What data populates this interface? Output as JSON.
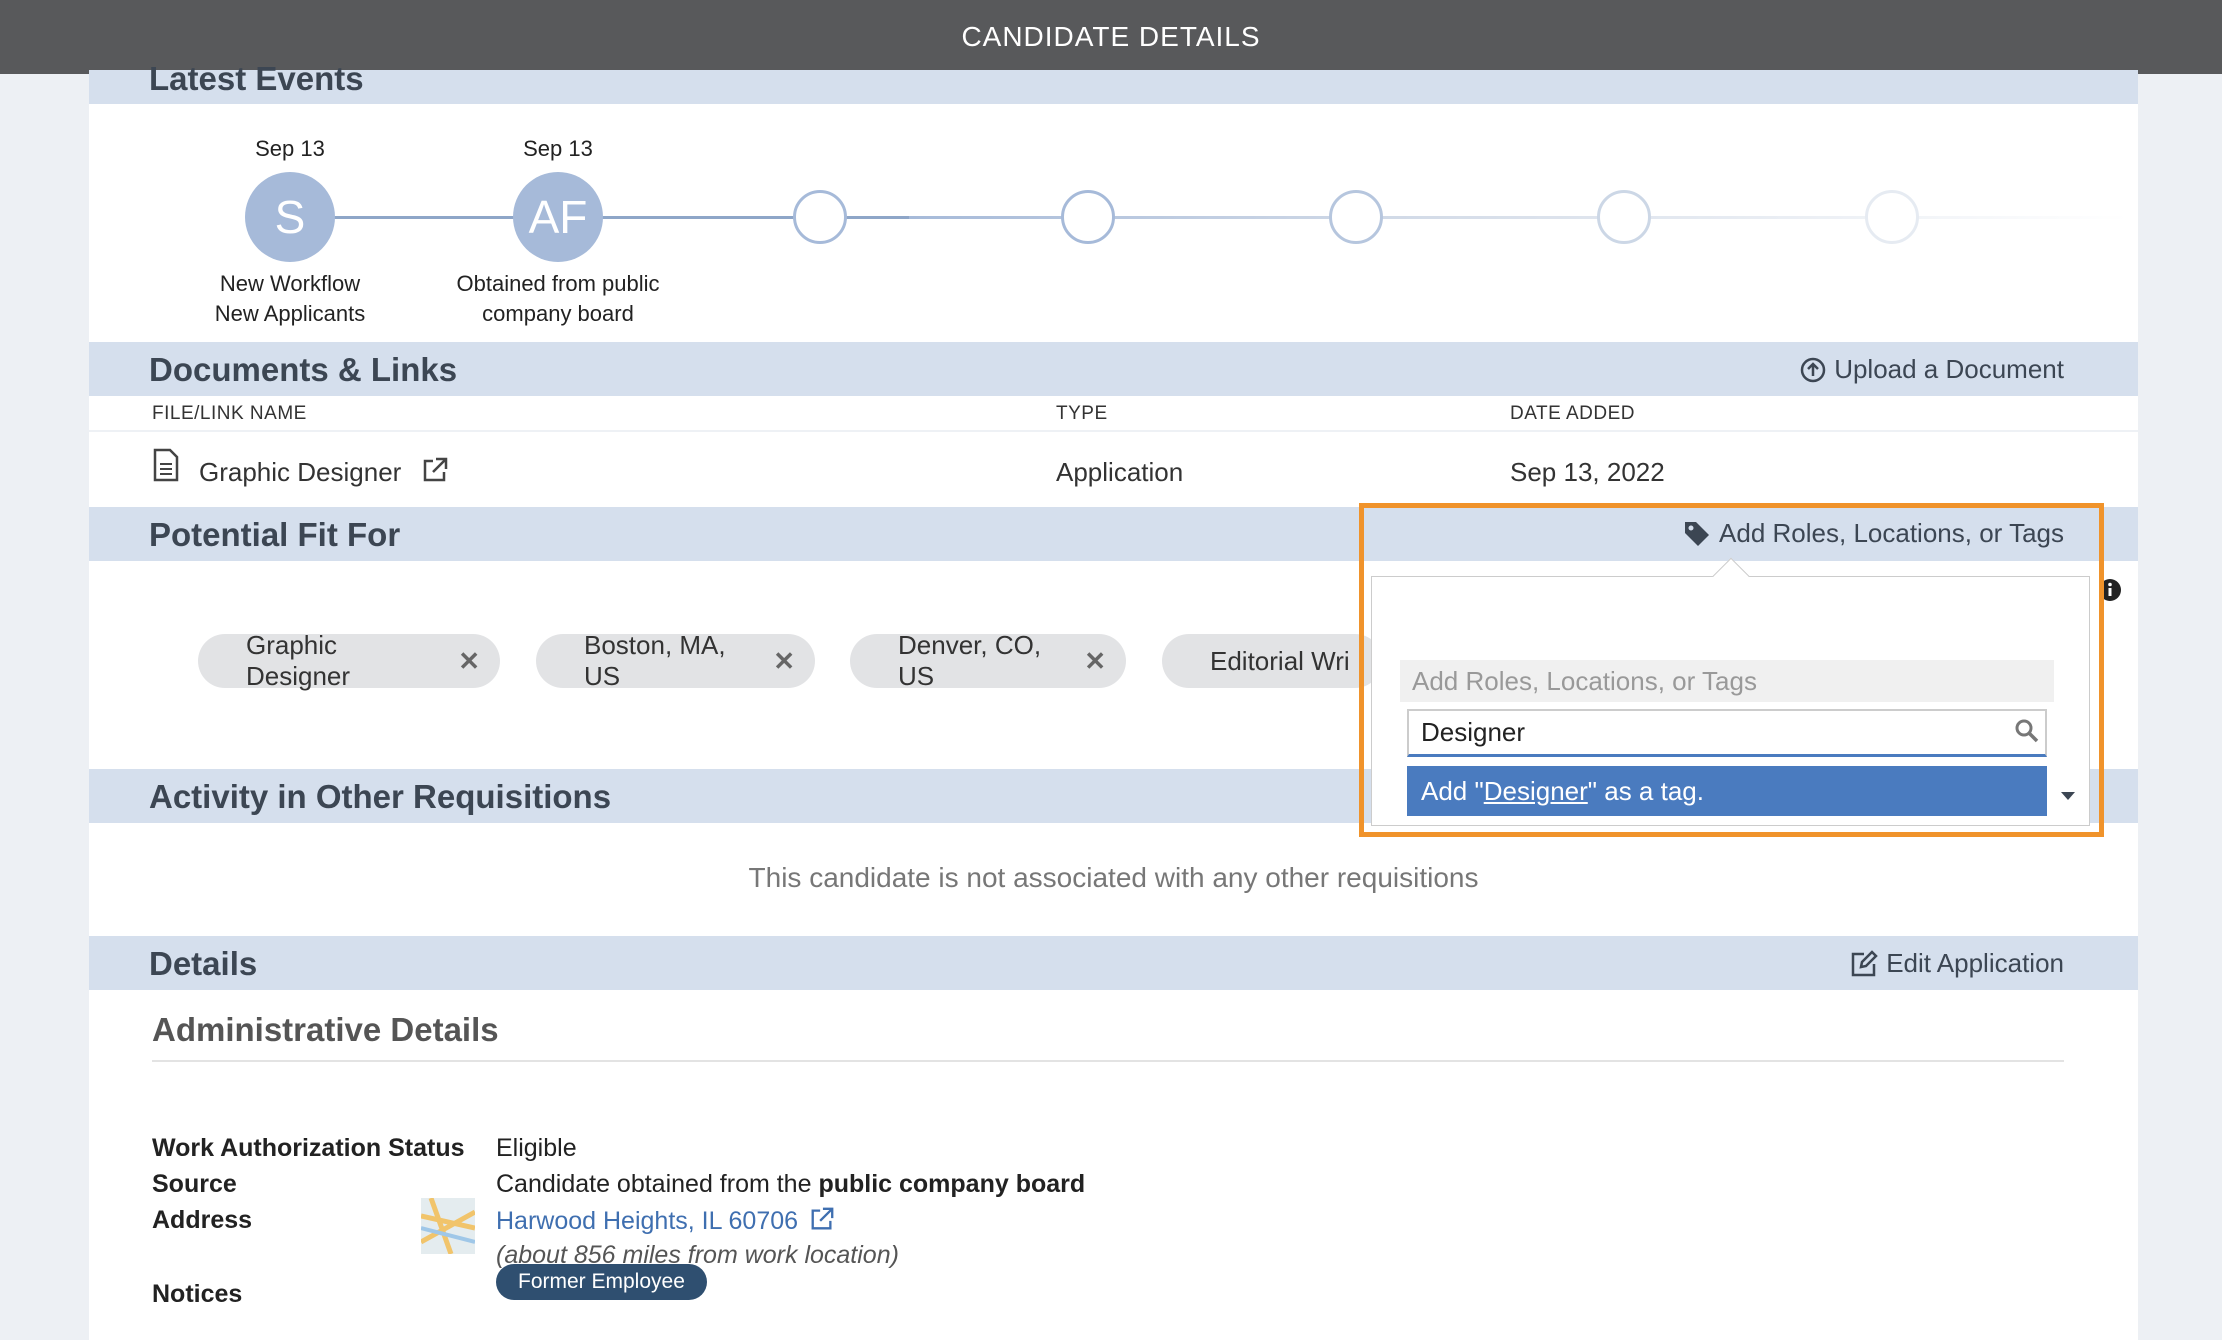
{
  "window": {
    "title": "CANDIDATE DETAILS"
  },
  "latest_events": {
    "title": "Latest Events",
    "events": [
      {
        "date": "Sep 13",
        "initials": "S",
        "label_line1": "New Workflow",
        "label_line2": "New Applicants"
      },
      {
        "date": "Sep 13",
        "initials": "AF",
        "label_line1": "Obtained from public",
        "label_line2": "company board"
      }
    ]
  },
  "documents": {
    "title": "Documents & Links",
    "upload_label": "Upload a Document",
    "columns": {
      "name": "FILE/LINK NAME",
      "type": "TYPE",
      "date": "DATE ADDED"
    },
    "rows": [
      {
        "name": "Graphic Designer",
        "type": "Application",
        "date": "Sep 13, 2022"
      }
    ]
  },
  "potential_fit": {
    "title": "Potential Fit For",
    "add_label": "Add Roles, Locations, or Tags",
    "chips": [
      "Graphic Designer",
      "Boston, MA, US",
      "Denver, CO, US",
      "Editorial Wri"
    ]
  },
  "tag_dropdown": {
    "placeholder": "Add Roles, Locations, or Tags",
    "search_value": "Designer",
    "option_prefix": "Add \"",
    "option_term": "Designer",
    "option_suffix": "\" as a tag."
  },
  "activity": {
    "title": "Activity in Other Requisitions",
    "empty_message": "This candidate is not associated with any other requisitions"
  },
  "details": {
    "title": "Details",
    "edit_label": "Edit Application",
    "admin_title": "Administrative Details",
    "work_auth_label": "Work Authorization Status",
    "work_auth_value": "Eligible",
    "source_label": "Source",
    "source_prefix": "Candidate obtained from the ",
    "source_bold": "public company board",
    "address_label": "Address",
    "address_link": "Harwood Heights, IL 60706",
    "address_distance": "(about 856 miles from work location)",
    "notices_label": "Notices",
    "notice_badge": "Former Employee"
  },
  "colors": {
    "accent": "#4a7bbf",
    "highlight": "#f0932b",
    "section_header": "#d5dfed",
    "titlebar": "#58595b"
  }
}
